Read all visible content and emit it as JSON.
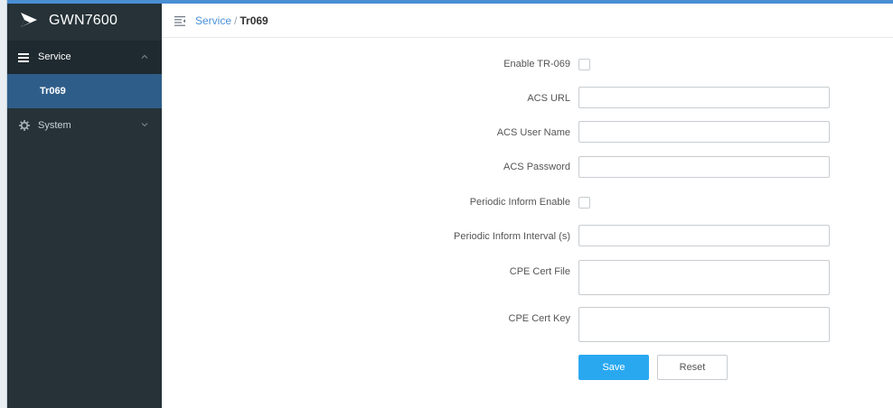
{
  "app": {
    "title": "GWN7600"
  },
  "sidebar": {
    "items": [
      {
        "label": "Service",
        "icon": "menu-lines-icon",
        "expanded": true
      },
      {
        "label": "Tr069",
        "active": true
      },
      {
        "label": "System",
        "icon": "gear-icon",
        "expanded": false
      }
    ]
  },
  "breadcrumb": {
    "parent": "Service",
    "separator": "/",
    "current": "Tr069"
  },
  "form": {
    "enable_tr069": {
      "label": "Enable TR-069",
      "checked": false
    },
    "acs_url": {
      "label": "ACS URL",
      "value": ""
    },
    "acs_user_name": {
      "label": "ACS User Name",
      "value": ""
    },
    "acs_password": {
      "label": "ACS Password",
      "value": ""
    },
    "periodic_inform_enable": {
      "label": "Periodic Inform Enable",
      "checked": false
    },
    "periodic_inform_interval": {
      "label": "Periodic Inform Interval (s)",
      "value": ""
    },
    "cpe_cert_file": {
      "label": "CPE Cert File",
      "value": ""
    },
    "cpe_cert_key": {
      "label": "CPE Cert Key",
      "value": ""
    }
  },
  "buttons": {
    "save": "Save",
    "reset": "Reset"
  },
  "colors": {
    "sidebar_bg": "#263238",
    "active_item_bg": "#2f5d89",
    "primary_button": "#29a8f0",
    "link": "#4a90d9"
  }
}
